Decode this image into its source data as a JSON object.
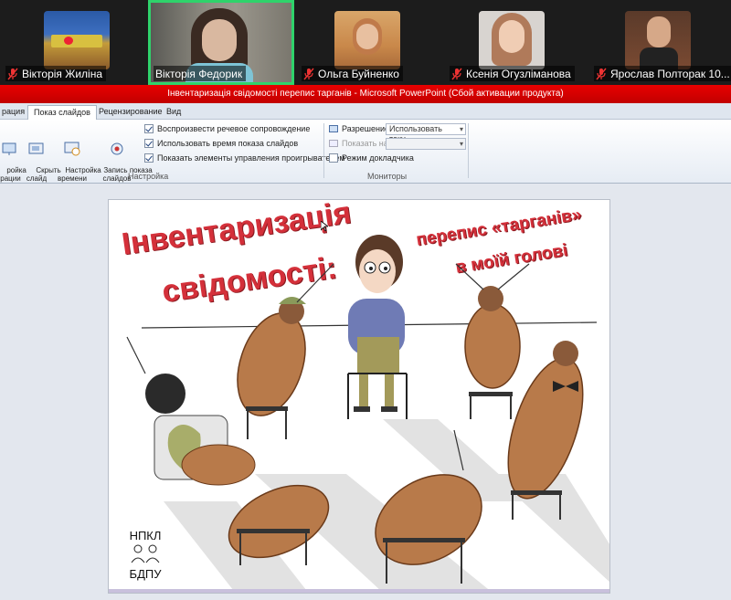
{
  "participants": [
    {
      "name": "Вікторія Жиліна",
      "muted": true,
      "active": false
    },
    {
      "name": "Вікторія Федорик",
      "muted": false,
      "active": true
    },
    {
      "name": "Ольга Буйненко",
      "muted": true,
      "active": false
    },
    {
      "name": "Ксенія Огузліманова",
      "muted": true,
      "active": false
    },
    {
      "name": "Ярослав Полторак 10...",
      "muted": true,
      "active": false
    }
  ],
  "window": {
    "title": "Інвентаризація свідомості перепис тарганів - Microsoft PowerPoint (Сбой активации продукта)"
  },
  "ribbon": {
    "tabs": [
      "рация",
      "Показ слайдов",
      "Рецензирование",
      "Вид"
    ],
    "selected_tab": "Показ слайдов",
    "buttons": {
      "setup_partial": "ройка\nграции",
      "hide_slide": "Скрыть\nслайд",
      "rehearse": "Настройка\nвремени",
      "record": "Запись показа\nслайдов"
    },
    "checkboxes": [
      {
        "label": "Воспроизвести речевое сопровождение",
        "checked": true
      },
      {
        "label": "Использовать время показа слайдов",
        "checked": true
      },
      {
        "label": "Показать элементы управления проигрывателем",
        "checked": true
      }
    ],
    "group_setup": "Настройка",
    "resolution_label": "Разрешение:",
    "resolution_value": "Использовать теку...",
    "show_on_label": "Показать на:",
    "show_on_value": "",
    "presenter_view": "Режим докладчика",
    "group_monitors": "Мониторы"
  },
  "slide": {
    "title_line1": "Інвентаризація",
    "title_line2": "свідомості:",
    "subtitle_line1": "перепис «тарганів»",
    "subtitle_line2": "в моїй голові",
    "logo_top": "НПКЛ",
    "logo_bottom": "БДПУ"
  },
  "colors": {
    "active_border": "#2fd36b",
    "titlebar": "#d60000",
    "slide_title": "#d4303a",
    "roach": "#b87a4a"
  }
}
